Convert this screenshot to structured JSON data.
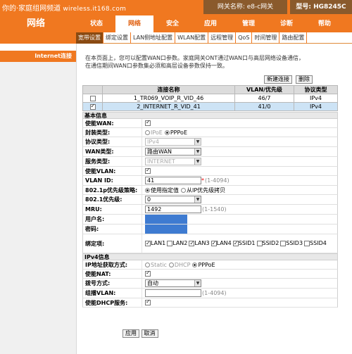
{
  "watermark": {
    "site": "你的·家庭组网频道",
    "url": "wireless.it168.com"
  },
  "header": {
    "gateway_name": "网关名称: e8-c网关",
    "model": "型号: HG8245C"
  },
  "brand": "网络",
  "nav": {
    "tabs": [
      "状态",
      "网络",
      "安全",
      "应用",
      "管理",
      "诊断",
      "帮助"
    ]
  },
  "subnav": {
    "tabs": [
      "宽带设置",
      "绑定设置",
      "LAN侧地址配置",
      "WLAN配置",
      "远程管理",
      "QoS",
      "时间管理",
      "路由配置"
    ]
  },
  "sidebar": {
    "item": "Internet连接"
  },
  "intro": {
    "line1": "在本页面上，您可以配置WAN口参数。家庭网关ONT通过WAN口与高层网络设备通信，",
    "line2": "在通信期间WAN口参数集必须和高层设备参数保持一致。"
  },
  "buttons": {
    "new_conn": "新建连接",
    "delete": "删除",
    "apply": "应用",
    "cancel": "取消"
  },
  "wan_table": {
    "headers": [
      "连接名称",
      "VLAN/优先级",
      "协议类型"
    ],
    "rows": [
      {
        "name": "1_TR069_VOIP_R_VID_46",
        "vlan": "46/7",
        "proto": "IPv4",
        "checked": false
      },
      {
        "name": "2_INTERNET_R_VID_41",
        "vlan": "41/0",
        "proto": "IPv4",
        "checked": true
      }
    ]
  },
  "basic": {
    "section": "基本信息",
    "enable_wan_label": "使能WAN:",
    "encap_label": "封装类型:",
    "encap_options": [
      "IPoE",
      "PPPoE"
    ],
    "proto_label": "协议类型:",
    "proto_value": "IPv4",
    "wantype_label": "WAN类型:",
    "wantype_value": "路由WAN",
    "service_label": "服务类型:",
    "service_value": "INTERNET",
    "enable_vlan_label": "使能VLAN:",
    "vlanid_label": "VLAN ID:",
    "vlanid_value": "41",
    "vlanid_hint": "(1-4094)",
    "req_mark": "*",
    "policy_label": "802.1p优先级策略:",
    "policy_options": [
      "使用指定值",
      "从IP优先级拷贝"
    ],
    "prio_label": "802.1优先级:",
    "prio_value": "0",
    "mru_label": "MRU:",
    "mru_value": "1492",
    "mru_hint": "(1-1540)",
    "user_label": "用户名:",
    "pass_label": "密码:",
    "bind_label": "绑定项:",
    "bind_items": [
      {
        "name": "LAN1",
        "checked": true
      },
      {
        "name": "LAN2",
        "checked": false
      },
      {
        "name": "LAN3",
        "checked": true
      },
      {
        "name": "LAN4",
        "checked": true
      },
      {
        "name": "SSID1",
        "checked": true
      },
      {
        "name": "SSID2",
        "checked": false
      },
      {
        "name": "SSID3",
        "checked": false
      },
      {
        "name": "SSID4",
        "checked": false
      }
    ]
  },
  "ipv4": {
    "section": "IPv4信息",
    "addr_label": "IP地址获取方式:",
    "addr_options": [
      "Static",
      "DHCP",
      "PPPoE"
    ],
    "nat_label": "使能NAT:",
    "dial_label": "拨号方式:",
    "dial_value": "自动",
    "mcast_label": "组播VLAN:",
    "mcast_hint": "(1-4094)",
    "dhcp_label": "使能DHCP服务:"
  },
  "colors": {
    "orange": "#f07820",
    "brown": "#8a5a2c",
    "select_blue": "#cde3f5",
    "mask_blue": "#3e7bd1"
  }
}
